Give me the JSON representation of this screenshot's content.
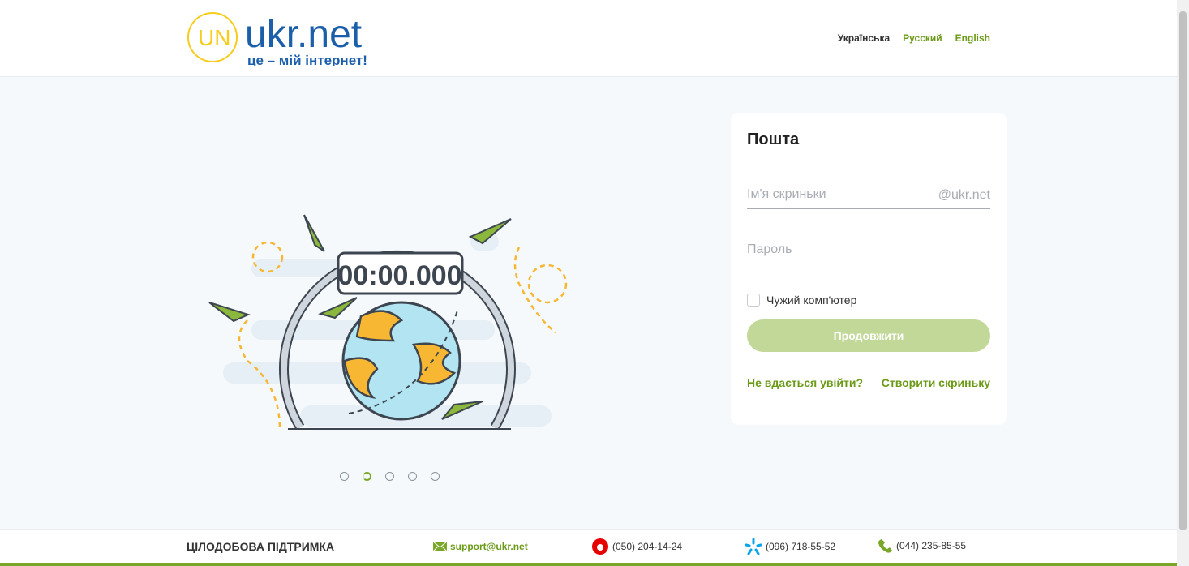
{
  "header": {
    "logo_text": "ukr.net",
    "logo_tagline": "це – мій інтернет!",
    "languages": [
      {
        "label": "Українська",
        "active": true
      },
      {
        "label": "Русский"
      },
      {
        "label": "English"
      }
    ]
  },
  "illustration": {
    "timer": "00:00.000",
    "slides": 5,
    "active_slide": 2
  },
  "login": {
    "title": "Пошта",
    "username_placeholder": "Ім'я скриньки",
    "domain_suffix": "@ukr.net",
    "password_placeholder": "Пароль",
    "remember_label": "Чужий комп'ютер",
    "submit_label": "Продовжити",
    "forgot_link": "Не вдається увійти?",
    "create_link": "Створити скриньку"
  },
  "footer": {
    "support_label": "ЦІЛОДОБОВА ПІДТРИМКА",
    "email": "support@ukr.net",
    "phones": [
      "(050) 204-14-24",
      "(096) 718-55-52",
      "(044) 235-85-55"
    ]
  },
  "colors": {
    "accent": "#7aa72a",
    "button": "#c2d899",
    "logo_blue": "#1b5fab",
    "logo_yellow": "#f7cc1c"
  }
}
